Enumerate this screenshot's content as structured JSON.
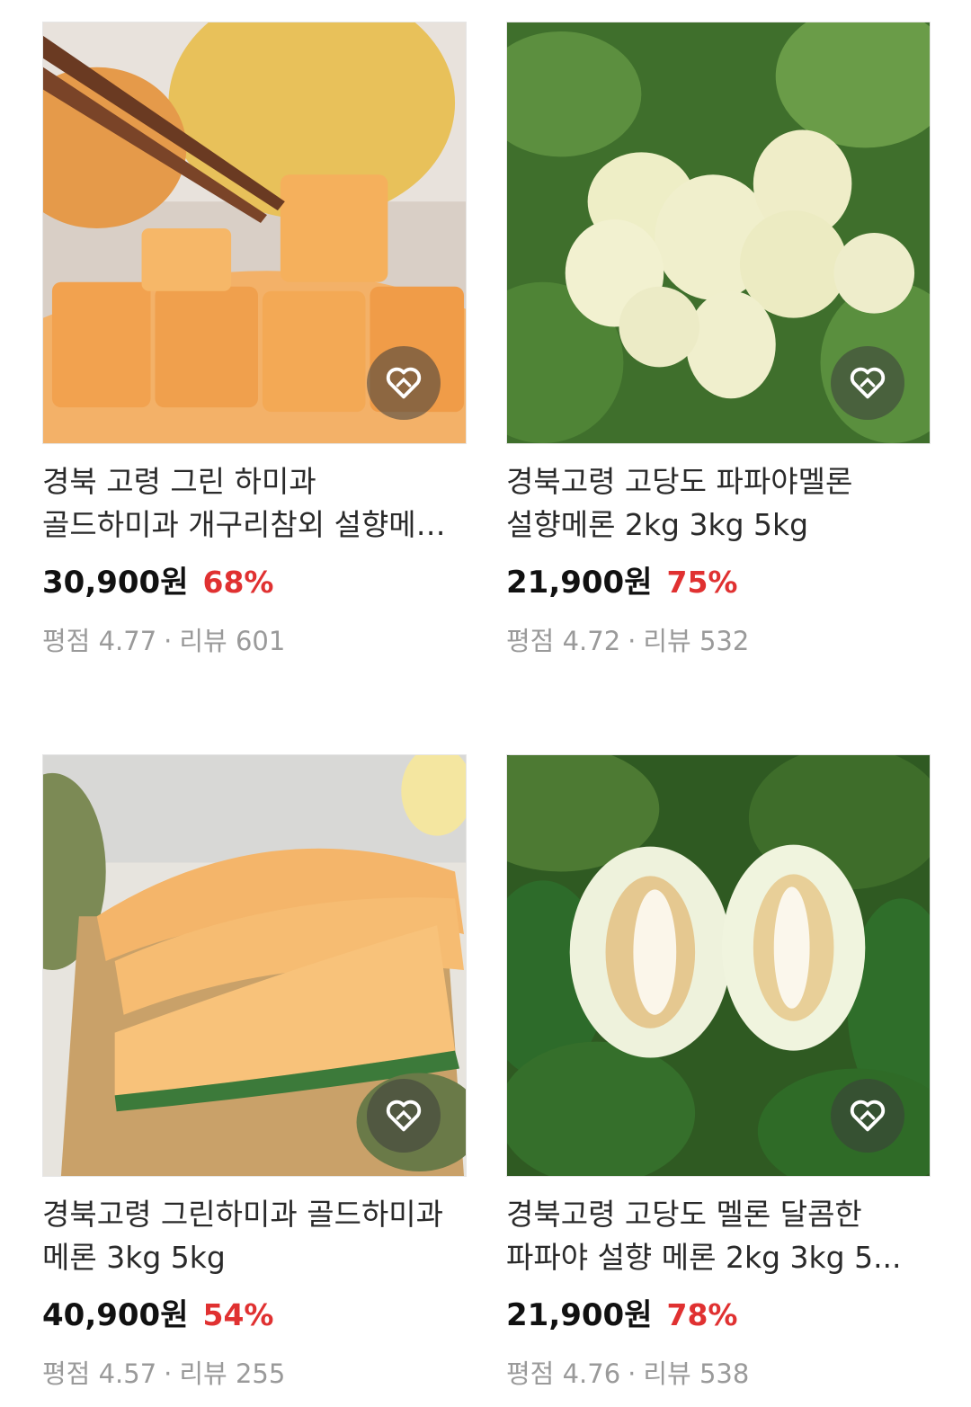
{
  "products": [
    {
      "title": "경북 고령 그린 하미과 골드하미과 개구리참외 설향메론 ...",
      "price": "30,900원",
      "discount": "68%",
      "rating_label": "평점 4.77",
      "review_label": "리뷰 601",
      "image_icon": "sliced-orange-melon-image"
    },
    {
      "title": "경북고령 고당도 파파야멜론 설향메론 2kg 3kg 5kg",
      "price": "21,900원",
      "discount": "75%",
      "rating_label": "평점 4.72",
      "review_label": "리뷰 532",
      "image_icon": "white-papaya-melons-image"
    },
    {
      "title": "경북고령 그린하미과 골드하미과 메론 3kg 5kg",
      "price": "40,900원",
      "discount": "54%",
      "rating_label": "평점 4.57",
      "review_label": "리뷰 255",
      "image_icon": "hami-melon-slices-image"
    },
    {
      "title": "경북고령 고당도 멜론 달콤한 파파야 설향 메론 2kg 3kg 5...",
      "price": "21,900원",
      "discount": "78%",
      "rating_label": "평점 4.76",
      "review_label": "리뷰 538",
      "image_icon": "halved-melon-image"
    }
  ],
  "separator": "·",
  "colors": {
    "discount": "#e03131",
    "meta": "#9a9a9a",
    "price": "#111111"
  }
}
